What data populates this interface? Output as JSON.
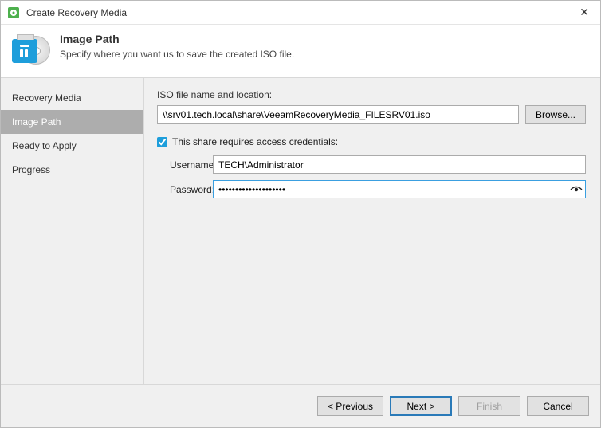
{
  "window": {
    "title": "Create Recovery Media"
  },
  "header": {
    "title": "Image Path",
    "subtitle": "Specify where you want us to save the created ISO file."
  },
  "sidebar": {
    "steps": [
      {
        "label": "Recovery Media"
      },
      {
        "label": "Image Path"
      },
      {
        "label": "Ready to Apply"
      },
      {
        "label": "Progress"
      }
    ]
  },
  "content": {
    "iso_label": "ISO file name and location:",
    "iso_path": "\\\\srv01.tech.local\\share\\VeeamRecoveryMedia_FILESRV01.iso",
    "browse_label": "Browse...",
    "credentials_checkbox_label": "This share requires access credentials:",
    "username_label": "Username:",
    "username_value": "TECH\\Administrator",
    "password_label": "Password:",
    "password_value": "••••••••••••••••••••"
  },
  "footer": {
    "previous": "< Previous",
    "next": "Next >",
    "finish": "Finish",
    "cancel": "Cancel"
  }
}
